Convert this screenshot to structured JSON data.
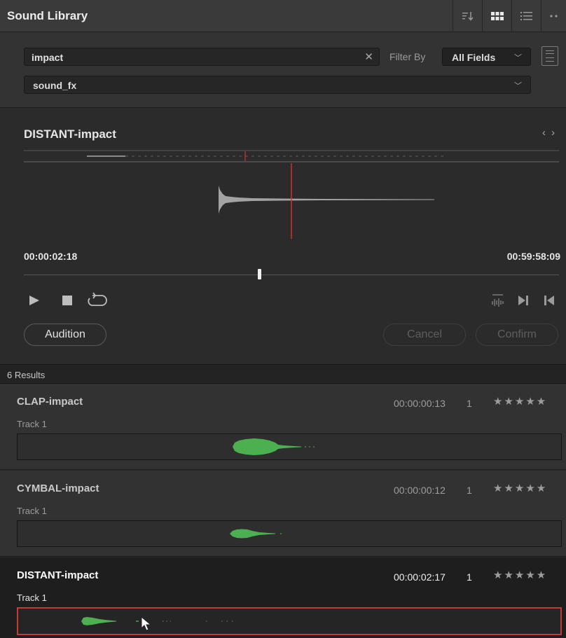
{
  "panel": {
    "title": "Sound Library",
    "toolbar": [
      "sort-icon",
      "grid-view-icon",
      "list-view-icon",
      "more-icon"
    ]
  },
  "search": {
    "query": "impact",
    "filter_label": "Filter By",
    "filter_value": "All Fields",
    "database": "sound_fx"
  },
  "preview": {
    "clip_name": "DISTANT-impact",
    "start_timecode": "00:00:02:18",
    "end_timecode": "00:59:58:09",
    "scrubber_position": 0.44,
    "audition_label": "Audition",
    "cancel_label": "Cancel",
    "confirm_label": "Confirm"
  },
  "results": {
    "count_label": "6 Results",
    "items": [
      {
        "name": "CLAP-impact",
        "track": "Track 1",
        "duration": "00:00:00:13",
        "count": "1",
        "stars": "★★★★★",
        "selected": false
      },
      {
        "name": "CYMBAL-impact",
        "track": "Track 1",
        "duration": "00:00:00:12",
        "count": "1",
        "stars": "★★★★★",
        "selected": false
      },
      {
        "name": "DISTANT-impact",
        "track": "Track 1",
        "duration": "00:00:02:17",
        "count": "1",
        "stars": "★★★★★",
        "selected": true
      }
    ]
  },
  "colors": {
    "waveform_green": "#4caf50",
    "playhead_red": "#d93030",
    "selected_border": "#c23a3a"
  }
}
